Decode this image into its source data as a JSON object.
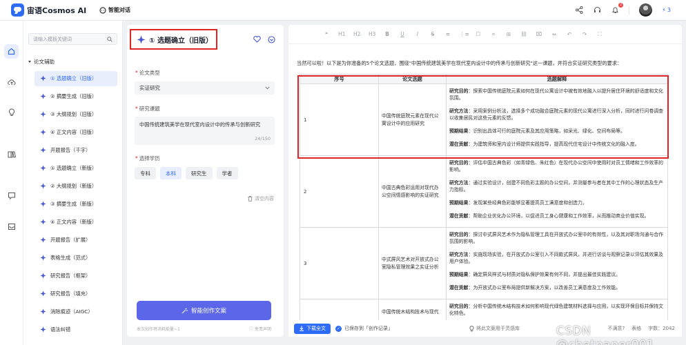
{
  "app": {
    "name": "宙语Cosmos AI",
    "tab": "智能对话",
    "points": "3",
    "notifications": "2"
  },
  "colors": {
    "accent": "#2f6cf6",
    "button": "#5b66e8",
    "highlight": "#e02424"
  },
  "sidebar": {
    "search_placeholder": "请输入模板关键词",
    "section": "论文辅助",
    "items": [
      {
        "label": "① 选题确立（旧版）",
        "icon": "sparkle-icon"
      },
      {
        "label": "② 摘要生成（旧版）",
        "icon": "sparkle-icon"
      },
      {
        "label": "③ 大纲规划（旧版）",
        "icon": "sparkle-icon"
      },
      {
        "label": "④ 正文内容（旧版）",
        "icon": "sparkle-icon"
      },
      {
        "label": "开题报告（千字）",
        "icon": "sparkle-icon"
      },
      {
        "label": "① 选题确立（新版）",
        "icon": "sparkle-icon"
      },
      {
        "label": "② 大纲规划（新版）",
        "icon": "sparkle-icon"
      },
      {
        "label": "③ 摘要生成（新版）",
        "icon": "sparkle-icon"
      },
      {
        "label": "④ 正文内容（新版）",
        "icon": "sparkle-icon"
      },
      {
        "label": "开题报告（扩展）",
        "icon": "sparkle-icon"
      },
      {
        "label": "表格生成（范式）",
        "icon": "sparkle-icon"
      },
      {
        "label": "研究报告（框架）",
        "icon": "sparkle-icon"
      },
      {
        "label": "研究报告（填充）",
        "icon": "sparkle-icon"
      },
      {
        "label": "消除痕迹（AIGC）",
        "icon": "sparkle-icon"
      },
      {
        "label": "语法纠错",
        "icon": "sparkle-icon"
      }
    ]
  },
  "form": {
    "title": "① 选题确立（旧版）",
    "type_label": "论文类型",
    "type_value": "实证研究",
    "topic_label": "研究课题",
    "topic_value": "中国传统建筑美学在现代室内设计中的传承与创新研究",
    "topic_count": "24/150",
    "level_label": "选择学历",
    "levels": [
      "专科",
      "本科",
      "研究生",
      "学者"
    ],
    "clear_label": "清空内容",
    "generate_label": "智能创作文案",
    "cost_note": "本次创作将消耗能量~1",
    "disclaimer": "免责声明"
  },
  "document": {
    "toolbar": [
      "❝",
      "H1",
      "H2",
      "H3",
      "B",
      "U",
      "I",
      "S",
      "≡",
      "⋮≡",
      "☐",
      "⌗",
      "⊞",
      "⛓",
      "⌧",
      "⇔",
      "↶",
      "↷",
      "⛶"
    ],
    "intro": "当然可以啦！以下是为你准备的5个论文选题，围绕\"中国传统建筑美学在现代室内设计中的传承与创新研究\"这一课题，并符合实证研究类型的要求：",
    "headers": [
      "序号",
      "论文选题",
      "选题解释"
    ],
    "rows": [
      {
        "num": "1",
        "topic": "中国传统庭院元素在现代公寓设计中的应用研究",
        "desc": [
          {
            "k": "研究目的",
            "v": "：探索中国传统庭院元素如何在现代公寓设计中被有效地融入以提升居住环境的舒适度和文化氛围。"
          },
          {
            "k": "研究方法",
            "v": "：采用案例分析法，选择多个成功融合庭院元素的现代公寓进行深入分析，同时进行问卷调查以收集居民对这些元素的反馈。"
          },
          {
            "k": "预期结果",
            "v": "：识别出具体可行的庭院元素及其应用策略，如采光、绿化、空间布局等。"
          },
          {
            "k": "潜在贡献",
            "v": "：为建筑师和室内设计师提供实践指导，提高现代住宅设计中传统文化的融入度。"
          }
        ]
      },
      {
        "num": "2",
        "topic": "中国古典色彩运用对现代办公空间情感影响的实证研究",
        "desc": [
          {
            "k": "研究目的",
            "v": "：评估中国古典色彩（如青绿色、朱红色）在现代办公空间中使用时对员工情绪和工作效率的影响。"
          },
          {
            "k": "研究方法",
            "v": "：通过实验设计，创建不同色彩主题的办公空间，并测量参与者在其中工作的心理状态及生产力指标。"
          },
          {
            "k": "预期结果",
            "v": "：发现某些经典色彩能够显著提高员工满意度和创造力。"
          },
          {
            "k": "潜在贡献",
            "v": "：帮助企业优化办公环境，以促进员工身心健康和工作效率，从而推动商业价值实现。"
          }
        ]
      },
      {
        "num": "3",
        "topic": "中式屏风艺术对开放式办公室隐私管理效果之实证分析",
        "desc": [
          {
            "k": "研究目的",
            "v": "：探讨中式屏风艺术作为隐私管理工具在开放式办公室中的有效性，以及其对职场沟通与合作氛围的影响。"
          },
          {
            "k": "研究方法",
            "v": "：实施现场实验，在开放式办公室引入不同款式屏风，并进行访谈与观察记录以评估其效果及用户体验。"
          },
          {
            "k": "预期结果",
            "v": "：确定屏风样式与材质对隐私保护效果有何不同，并提出最佳实践建议。"
          },
          {
            "k": "潜在贡献",
            "v": "：为开放式办公室布局提供新解决方案，以改善员工满意度及工作效能。"
          }
        ]
      },
      {
        "num": "",
        "topic": "中国传统木结构技术与现代",
        "desc": [
          {
            "k": "研究目的",
            "v": "：分析中国传统木结构技术如何影响现代绿色建筑材料选择与应用，以实现环保目标并保持文化特色。"
          }
        ]
      }
    ],
    "download_label": "下载全文",
    "saved_text": "已保存到「创作记录」",
    "inspire_text": "将此文案用于灵感库",
    "dislike": "不满意?",
    "table_label": "表格",
    "wordcount": "字数：2042"
  },
  "watermark": "CSDN @chatpaper001"
}
